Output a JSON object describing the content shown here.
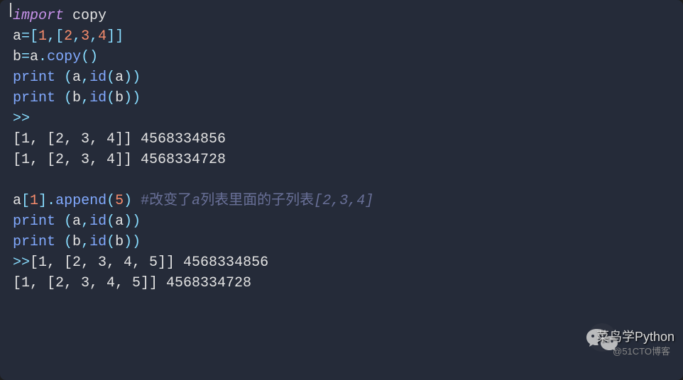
{
  "code": {
    "l1": {
      "import_kw": "import",
      "mod": "copy"
    },
    "l2": {
      "var": "a",
      "eq": "=",
      "lb1": "[",
      "n1": "1",
      "c1": ",",
      "lb2": "[",
      "n2": "2",
      "c2": ",",
      "n3": "3",
      "c3": ",",
      "n4": "4",
      "rb2": "]",
      "rb1": "]"
    },
    "l3": {
      "var": "b",
      "eq": "=",
      "obj": "a",
      "dot": ".",
      "meth": "copy",
      "lp": "(",
      "rp": ")"
    },
    "l4": {
      "fn": "print",
      "sp": " ",
      "lp": "(",
      "a1": "a",
      "c": ",",
      "id": "id",
      "lp2": "(",
      "a2": "a",
      "rp2": ")",
      "rp": ")"
    },
    "l5": {
      "fn": "print",
      "sp": " ",
      "lp": "(",
      "a1": "b",
      "c": ",",
      "id": "id",
      "lp2": "(",
      "a2": "b",
      "rp2": ")",
      "rp": ")"
    },
    "l6": {
      "prompt": ">>"
    },
    "l7": {
      "txt": "[1, [2, 3, 4]] 4568334856"
    },
    "l8": {
      "txt": "[1, [2, 3, 4]] 4568334728"
    },
    "l10": {
      "obj": "a",
      "lb": "[",
      "idx": "1",
      "rb": "]",
      "dot": ".",
      "meth": "append",
      "lp": "(",
      "arg": "5",
      "rp": ")",
      "sp": " ",
      "hash": "#",
      "cm_a": "改变了",
      "cm_b": "a",
      "cm_c": "列表里面的子列表",
      "cm_d": "[2,3,4]"
    },
    "l11": {
      "fn": "print",
      "sp": " ",
      "lp": "(",
      "a1": "a",
      "c": ",",
      "id": "id",
      "lp2": "(",
      "a2": "a",
      "rp2": ")",
      "rp": ")"
    },
    "l12": {
      "fn": "print",
      "sp": " ",
      "lp": "(",
      "a1": "b",
      "c": ",",
      "id": "id",
      "lp2": "(",
      "a2": "b",
      "rp2": ")",
      "rp": ")"
    },
    "l13": {
      "prompt": ">>",
      "txt": "[1, [2, 3, 4, 5]] 4568334856"
    },
    "l14": {
      "txt": "[1, [2, 3, 4, 5]] 4568334728"
    }
  },
  "watermark": {
    "label": "菜鸟学Python",
    "sub": "@51CTO博客"
  }
}
